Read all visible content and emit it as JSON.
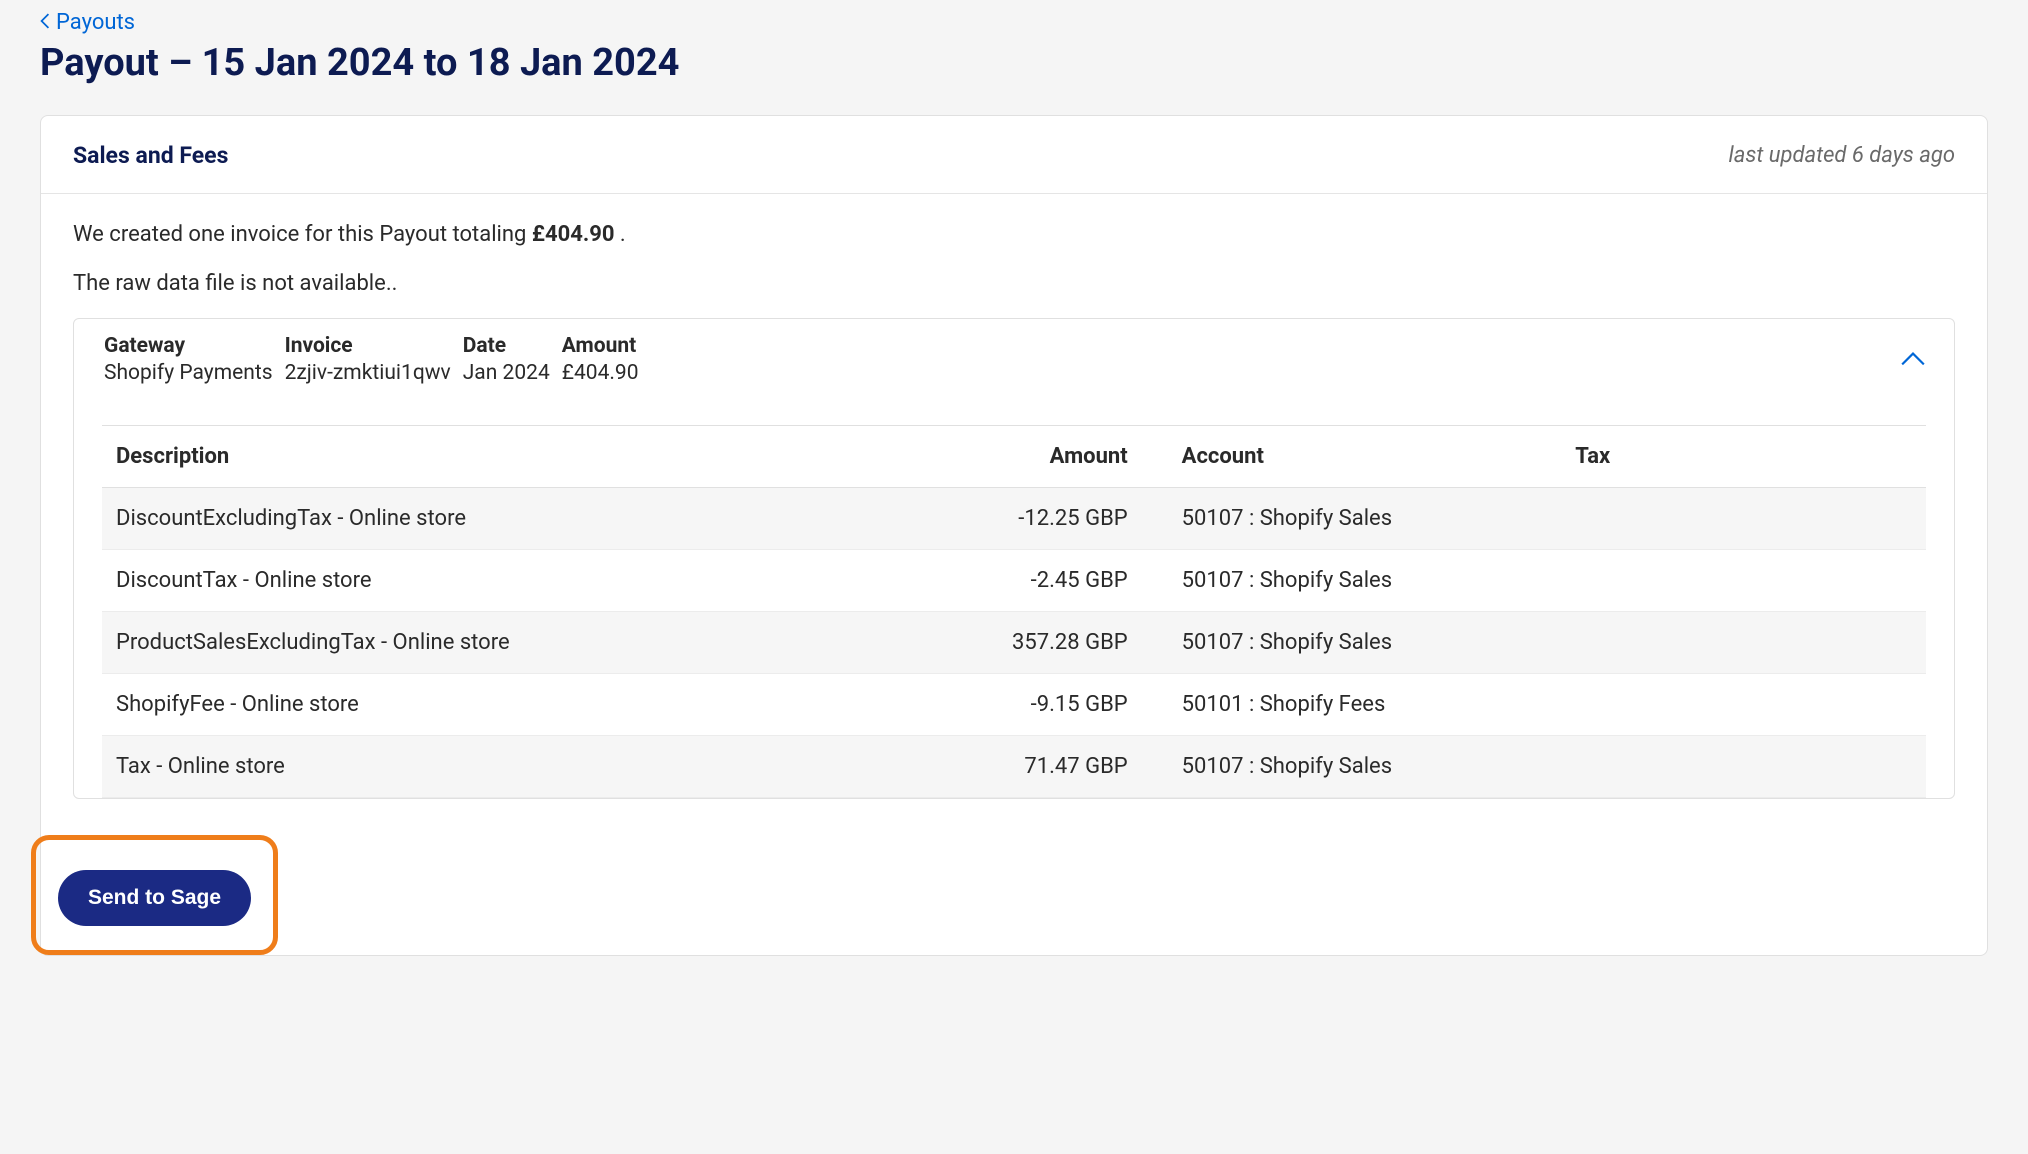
{
  "breadcrumb": {
    "label": "Payouts"
  },
  "page_title": "Payout – 15 Jan 2024 to 18 Jan 2024",
  "card": {
    "title": "Sales and Fees",
    "last_updated": "last updated 6 days ago",
    "summary_prefix": "We created one invoice for this Payout totaling ",
    "summary_amount": "£404.90",
    "summary_suffix": " .",
    "raw_data_note": "The raw data file is not available..",
    "accordion": {
      "meta": [
        {
          "label": "Gateway",
          "value": "Shopify Payments"
        },
        {
          "label": "Invoice",
          "value": "2zjiv-zmktiui1qwv"
        },
        {
          "label": "Date",
          "value": "Jan 2024"
        },
        {
          "label": "Amount",
          "value": "£404.90"
        }
      ]
    },
    "table": {
      "headers": {
        "description": "Description",
        "amount": "Amount",
        "account": "Account",
        "tax": "Tax"
      },
      "rows": [
        {
          "description": "DiscountExcludingTax - Online store",
          "amount": "-12.25 GBP",
          "account": "50107 : Shopify Sales",
          "tax": ""
        },
        {
          "description": "DiscountTax - Online store",
          "amount": "-2.45 GBP",
          "account": "50107 : Shopify Sales",
          "tax": ""
        },
        {
          "description": "ProductSalesExcludingTax - Online store",
          "amount": "357.28 GBP",
          "account": "50107 : Shopify Sales",
          "tax": ""
        },
        {
          "description": "ShopifyFee - Online store",
          "amount": "-9.15 GBP",
          "account": "50101 : Shopify Fees",
          "tax": ""
        },
        {
          "description": "Tax - Online store",
          "amount": "71.47 GBP",
          "account": "50107 : Shopify Sales",
          "tax": ""
        }
      ]
    }
  },
  "actions": {
    "send_to_sage": "Send to Sage"
  }
}
